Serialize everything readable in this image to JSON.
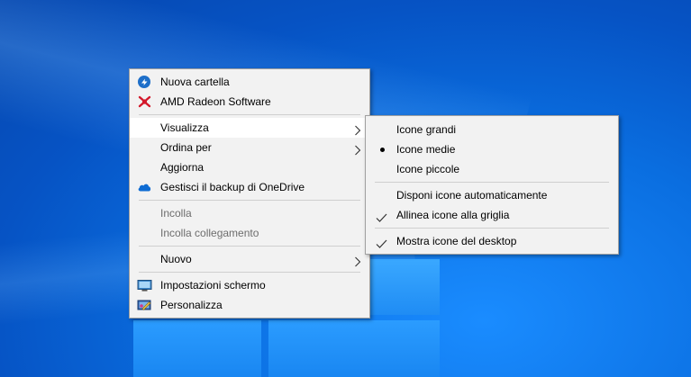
{
  "desktop": {
    "accent_color": "#0a6ee0"
  },
  "context_menu": {
    "items": [
      {
        "label": "Nuova cartella",
        "icon": "folder-sync-icon"
      },
      {
        "label": "AMD Radeon Software",
        "icon": "amd-radeon-icon"
      },
      {
        "label": "Visualizza",
        "has_submenu": true,
        "highlighted": true
      },
      {
        "label": "Ordina per",
        "has_submenu": true
      },
      {
        "label": "Aggiorna"
      },
      {
        "label": "Gestisci il backup di OneDrive",
        "icon": "onedrive-cloud-icon"
      },
      {
        "label": "Incolla",
        "disabled": true
      },
      {
        "label": "Incolla collegamento",
        "disabled": true
      },
      {
        "label": "Nuovo",
        "has_submenu": true
      },
      {
        "label": "Impostazioni schermo",
        "icon": "display-settings-icon"
      },
      {
        "label": "Personalizza",
        "icon": "personalize-icon"
      }
    ]
  },
  "submenu": {
    "items": [
      {
        "label": "Icone grandi"
      },
      {
        "label": "Icone medie",
        "selected": true
      },
      {
        "label": "Icone piccole"
      },
      {
        "label": "Disponi icone automaticamente"
      },
      {
        "label": "Allinea icone alla griglia",
        "checked": true
      },
      {
        "label": "Mostra icone del desktop",
        "checked": true
      }
    ]
  }
}
